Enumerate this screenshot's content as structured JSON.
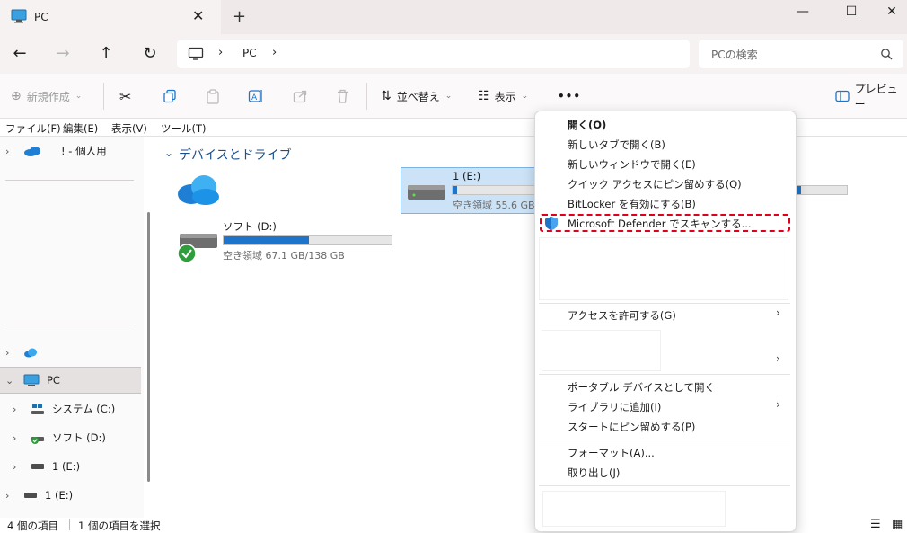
{
  "window": {
    "tab_title": "PC",
    "new_tab": "+",
    "minimize": "—",
    "maximize": "☐",
    "close": "✕"
  },
  "address": {
    "crumb": "PC",
    "search_placeholder": "PCの検索"
  },
  "toolbar": {
    "new_label": "新規作成",
    "sort_label": "並べ替え",
    "view_label": "表示",
    "more_label": "•••",
    "preview_label": "プレビュー"
  },
  "menubar": [
    "ファイル(F)",
    "編集(E)",
    "表示(V)",
    "ツール(T)"
  ],
  "sidebar": {
    "onedrive_label": "! - 個人用",
    "pc_label": "PC",
    "items": [
      "システム (C:)",
      "ソフト (D:)",
      "1 (E:)",
      "1 (E:)"
    ]
  },
  "main": {
    "group_title": "デバイスとドライブ",
    "drives": [
      {
        "name": "ソフト (D:)",
        "space": "空き領域 67.1 GB/138 GB",
        "used_fraction": 0.51
      },
      {
        "name": "1 (E:)",
        "space": "空き領域 55.6 GB/",
        "used_fraction": 0.05
      }
    ]
  },
  "status": {
    "count": "4 個の項目",
    "selected": "1 個の項目を選択"
  },
  "context_menu": {
    "items": [
      "開く(O)",
      "新しいタブで開く(B)",
      "新しいウィンドウで開く(E)",
      "クイック アクセスにピン留めする(Q)",
      "BitLocker を有効にする(B)",
      "Microsoft Defender でスキャンする...",
      "アクセスを許可する(G)",
      "ポータブル デバイスとして開く",
      "ライブラリに追加(I)",
      "スタートにピン留めする(P)",
      "フォーマット(A)...",
      "取り出し(J)"
    ],
    "submenu_arrow": "›"
  },
  "colors": {
    "accent": "#1e74c9",
    "highlight": "#e0001b",
    "selection": "#cce3f7"
  }
}
